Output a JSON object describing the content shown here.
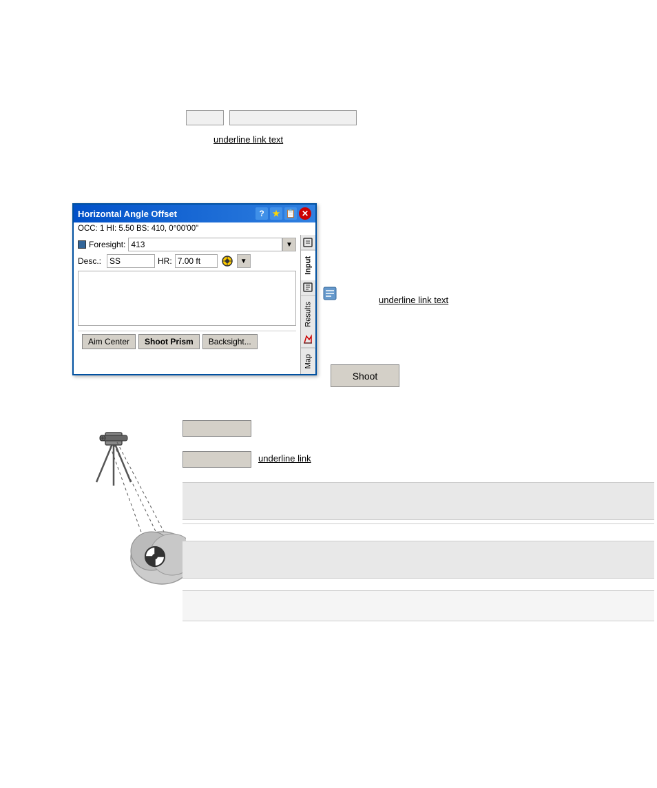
{
  "top": {
    "box1_label": "",
    "box2_label": "",
    "link_text": "underline link text"
  },
  "dialog": {
    "title": "Horizontal Angle Offset",
    "info_line": "OCC: 1  HI: 5.50  BS: 410, 0°00'00\"",
    "foresight_label": "Foresight:",
    "foresight_value": "413",
    "desc_label": "Desc.:",
    "desc_value": "SS",
    "hr_label": "HR:",
    "hr_value": "7.00 ft",
    "textarea_value": "",
    "btn_aim": "Aim Center",
    "btn_shoot": "Shoot Prism",
    "btn_backsight": "Backsight...",
    "tabs": [
      {
        "label": "Input",
        "active": true
      },
      {
        "label": "Results",
        "active": false
      },
      {
        "label": "Map",
        "active": false
      }
    ]
  },
  "shoot_btn_label": "Shoot",
  "below_btn1_label": "",
  "below_btn2_label": "",
  "link2_text": "underline link",
  "gray_block1_text": "",
  "gray_block2_text": "",
  "gray_block3_text": ""
}
